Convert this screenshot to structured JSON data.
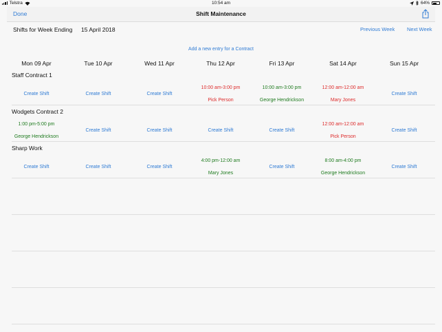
{
  "status_bar": {
    "carrier": "Telstra",
    "time": "10:54 am",
    "battery": "64%",
    "battery_level": 0.64
  },
  "nav": {
    "done_label": "Done",
    "title": "Shift Maintenance"
  },
  "week": {
    "label": "Shifts for Week Ending",
    "date": "15 April 2018",
    "prev_label": "Previous Week",
    "next_label": "Next Week"
  },
  "add_entry_label": "Add a new entry for a Contract",
  "days": [
    "Mon 09 Apr",
    "Tue 10 Apr",
    "Wed 11 Apr",
    "Thu 12 Apr",
    "Fri 13 Apr",
    "Sat 14 Apr",
    "Sun 15 Apr"
  ],
  "colors": {
    "link": "#2f7bd4",
    "unassigned": "#dd2a2a",
    "assigned": "#1e7a1e"
  },
  "contracts": [
    {
      "name": "Staff Contract 1",
      "cells": [
        {
          "type": "create",
          "label": "Create Shift"
        },
        {
          "type": "create",
          "label": "Create Shift"
        },
        {
          "type": "create",
          "label": "Create Shift"
        },
        {
          "type": "shift",
          "status": "unassigned",
          "time": "10:00 am-3:00 pm",
          "person": "Pick Person"
        },
        {
          "type": "shift",
          "status": "assigned",
          "time": "10:00 am-3:00 pm",
          "person": "George  Hendrickson"
        },
        {
          "type": "shift",
          "status": "unassigned",
          "time": "12:00 am-12:00 am",
          "person": "Mary Jones"
        },
        {
          "type": "create",
          "label": "Create Shift"
        }
      ]
    },
    {
      "name": "Wodgets Contract 2",
      "cells": [
        {
          "type": "shift",
          "status": "assigned",
          "time": "1:00 pm-5:00 pm",
          "person": "George  Hendrickson"
        },
        {
          "type": "create",
          "label": "Create Shift"
        },
        {
          "type": "create",
          "label": "Create Shift"
        },
        {
          "type": "create",
          "label": "Create Shift"
        },
        {
          "type": "create",
          "label": "Create Shift"
        },
        {
          "type": "shift",
          "status": "unassigned",
          "time": "12:00 am-12:00 am",
          "person": "Pick Person"
        },
        {
          "type": "create",
          "label": "Create Shift"
        }
      ]
    },
    {
      "name": "Sharp Work",
      "cells": [
        {
          "type": "create",
          "label": "Create Shift"
        },
        {
          "type": "create",
          "label": "Create Shift"
        },
        {
          "type": "create",
          "label": "Create Shift"
        },
        {
          "type": "shift",
          "status": "assigned",
          "time": "4:00 pm-12:00 am",
          "person": "Mary Jones"
        },
        {
          "type": "create",
          "label": "Create Shift"
        },
        {
          "type": "shift",
          "status": "assigned",
          "time": "8:00 am-4:00 pm",
          "person": "George  Hendrickson"
        },
        {
          "type": "create",
          "label": "Create Shift"
        }
      ]
    }
  ]
}
